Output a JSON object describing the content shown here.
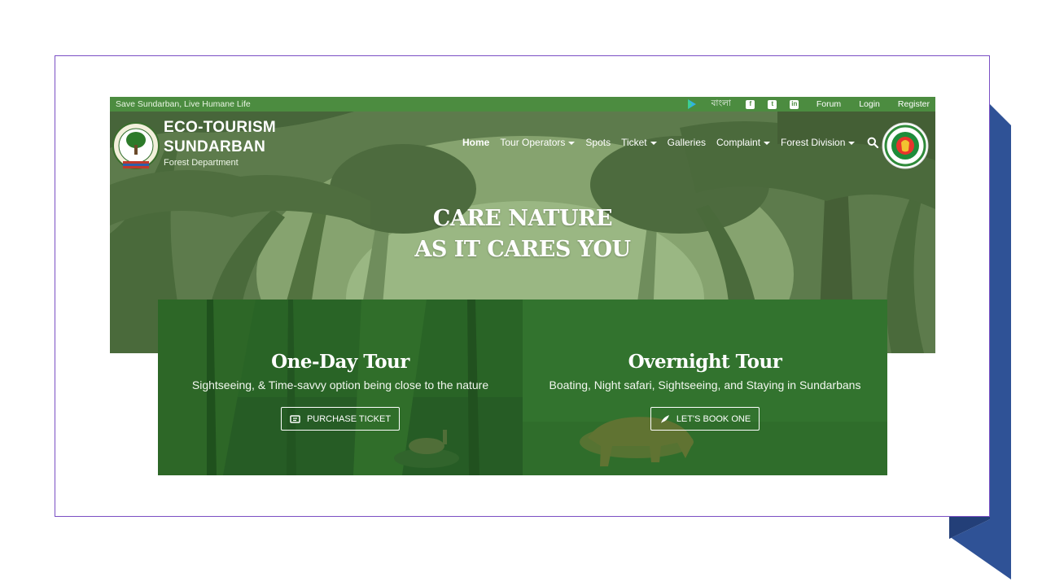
{
  "topbar": {
    "tagline": "Save Sundarban, Live Humane Life",
    "language": "বাংলা",
    "links": [
      "Forum",
      "Login",
      "Register"
    ]
  },
  "brand": {
    "title_line1": "ECO-TOURISM",
    "title_line2": "SUNDARBAN",
    "subtitle": "Forest Department"
  },
  "nav": {
    "items": [
      {
        "label": "Home",
        "active": true,
        "dropdown": false
      },
      {
        "label": "Tour Operators",
        "dropdown": true
      },
      {
        "label": "Spots",
        "dropdown": false
      },
      {
        "label": "Ticket",
        "dropdown": true
      },
      {
        "label": "Galleries",
        "dropdown": false
      },
      {
        "label": "Complaint",
        "dropdown": true
      },
      {
        "label": "Forest Division",
        "dropdown": true
      }
    ]
  },
  "hero": {
    "line1": "CARE NATURE",
    "line2": "AS IT CARES YOU"
  },
  "cards": [
    {
      "title": "One-Day Tour",
      "description": "Sightseeing, & Time-savvy option being close to the nature",
      "button": "PURCHASE TICKET",
      "button_icon": "ticket-icon"
    },
    {
      "title": "Overnight Tour",
      "description": "Boating, Night safari, Sightseeing, and Staying in Sundarbans",
      "button": "LET'S BOOK ONE",
      "button_icon": "feather-icon"
    }
  ],
  "colors": {
    "topbar": "#4c8c40",
    "hero": "#5b7a4a",
    "frame_border": "#7a4fc4",
    "deco_blue": "#2f5296"
  }
}
